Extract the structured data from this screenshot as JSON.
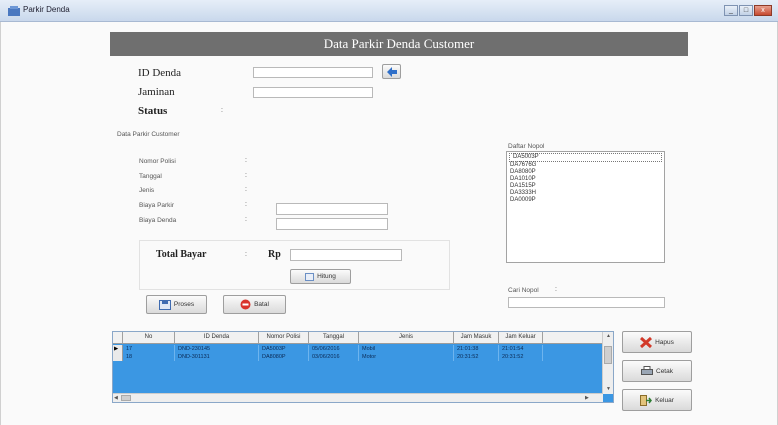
{
  "window": {
    "title": "Parkir Denda",
    "min": "_",
    "max": "□",
    "close": "x"
  },
  "header": {
    "title": "Data Parkir Denda Customer"
  },
  "form": {
    "id_denda_label": "ID Denda",
    "jaminan_label": "Jaminan",
    "status_label": "Status",
    "colon": ":"
  },
  "customer": {
    "section_label": "Data Parkir Customer",
    "nomor_polisi_label": "Nomor Polisi",
    "tanggal_label": "Tanggal",
    "jenis_label": "Jenis",
    "biaya_parkir_label": "Biaya Parkir",
    "biaya_denda_label": "Biaya Denda",
    "colon": ":"
  },
  "total": {
    "label": "Total Bayar",
    "colon": ":",
    "currency": "Rp",
    "hitung_label": "Hitung"
  },
  "actions": {
    "proses_label": "Proses",
    "batal_label": "Batal"
  },
  "daftar": {
    "label": "Daftar Nopol",
    "items": [
      "DA5003P",
      "DA7676G",
      "DA8080P",
      "DA1010P",
      "DA1515P",
      "DA3333H",
      "DA0009P"
    ]
  },
  "cari": {
    "label": "Cari Nopol",
    "colon": ":"
  },
  "grid": {
    "columns": [
      "No",
      "ID Denda",
      "Nomor Polisi",
      "Tanggal",
      "Jenis",
      "Jam Masuk",
      "Jam Keluar"
    ],
    "rows": [
      {
        "marker": "▶",
        "cells": [
          "17",
          "DND-230145",
          "DA5003P",
          "05/06/2016",
          "Mobil",
          "21:01:38",
          "21:01:54"
        ]
      },
      {
        "marker": "",
        "cells": [
          "18",
          "DND-301131",
          "DA8080P",
          "03/06/2016",
          "Motor",
          "20:31:52",
          "20:31:52"
        ]
      }
    ]
  },
  "side_buttons": {
    "hapus": "Hapus",
    "cetak": "Cetak",
    "keluar": "Keluar"
  }
}
